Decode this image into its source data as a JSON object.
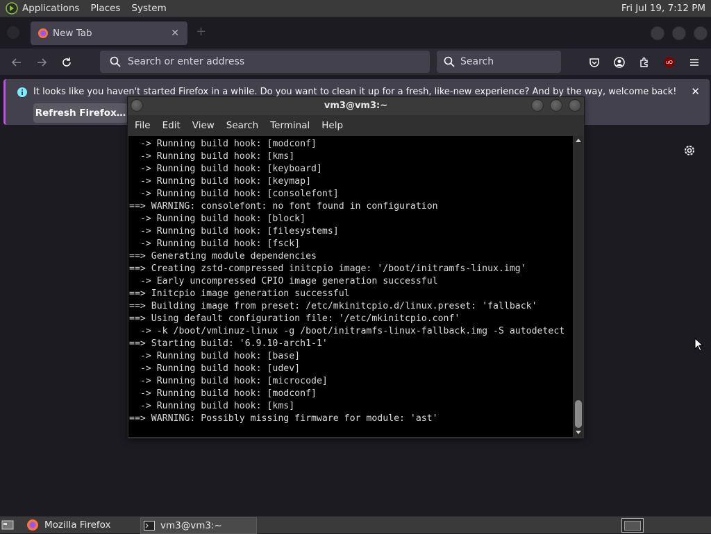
{
  "top_panel": {
    "menus": [
      "Applications",
      "Places",
      "System"
    ],
    "clock": "Fri Jul 19, 7:12 PM"
  },
  "browser": {
    "tab_title": "New Tab",
    "address_placeholder": "Search or enter address",
    "search_placeholder": "Search",
    "notification": {
      "message": "It looks like you haven't started Firefox in a while. Do you want to clean it up for a fresh, like-new experience? And by the way, welcome back!",
      "button_label": "Refresh Firefox…"
    },
    "ublock_badge": "uO"
  },
  "terminal": {
    "title": "vm3@vm3:~",
    "menu": [
      "File",
      "Edit",
      "View",
      "Search",
      "Terminal",
      "Help"
    ],
    "lines": [
      "  -> Running build hook: [modconf]",
      "  -> Running build hook: [kms]",
      "  -> Running build hook: [keyboard]",
      "  -> Running build hook: [keymap]",
      "  -> Running build hook: [consolefont]",
      "==> WARNING: consolefont: no font found in configuration",
      "  -> Running build hook: [block]",
      "  -> Running build hook: [filesystems]",
      "  -> Running build hook: [fsck]",
      "==> Generating module dependencies",
      "==> Creating zstd-compressed initcpio image: '/boot/initramfs-linux.img'",
      "  -> Early uncompressed CPIO image generation successful",
      "==> Initcpio image generation successful",
      "==> Building image from preset: /etc/mkinitcpio.d/linux.preset: 'fallback'",
      "==> Using default configuration file: '/etc/mkinitcpio.conf'",
      "  -> -k /boot/vmlinuz-linux -g /boot/initramfs-linux-fallback.img -S autodetect",
      "==> Starting build: '6.9.10-arch1-1'",
      "  -> Running build hook: [base]",
      "  -> Running build hook: [udev]",
      "  -> Running build hook: [microcode]",
      "  -> Running build hook: [modconf]",
      "  -> Running build hook: [kms]",
      "==> WARNING: Possibly missing firmware for module: 'ast'"
    ]
  },
  "taskbar": {
    "items": [
      "Mozilla Firefox",
      "vm3@vm3:~"
    ]
  }
}
